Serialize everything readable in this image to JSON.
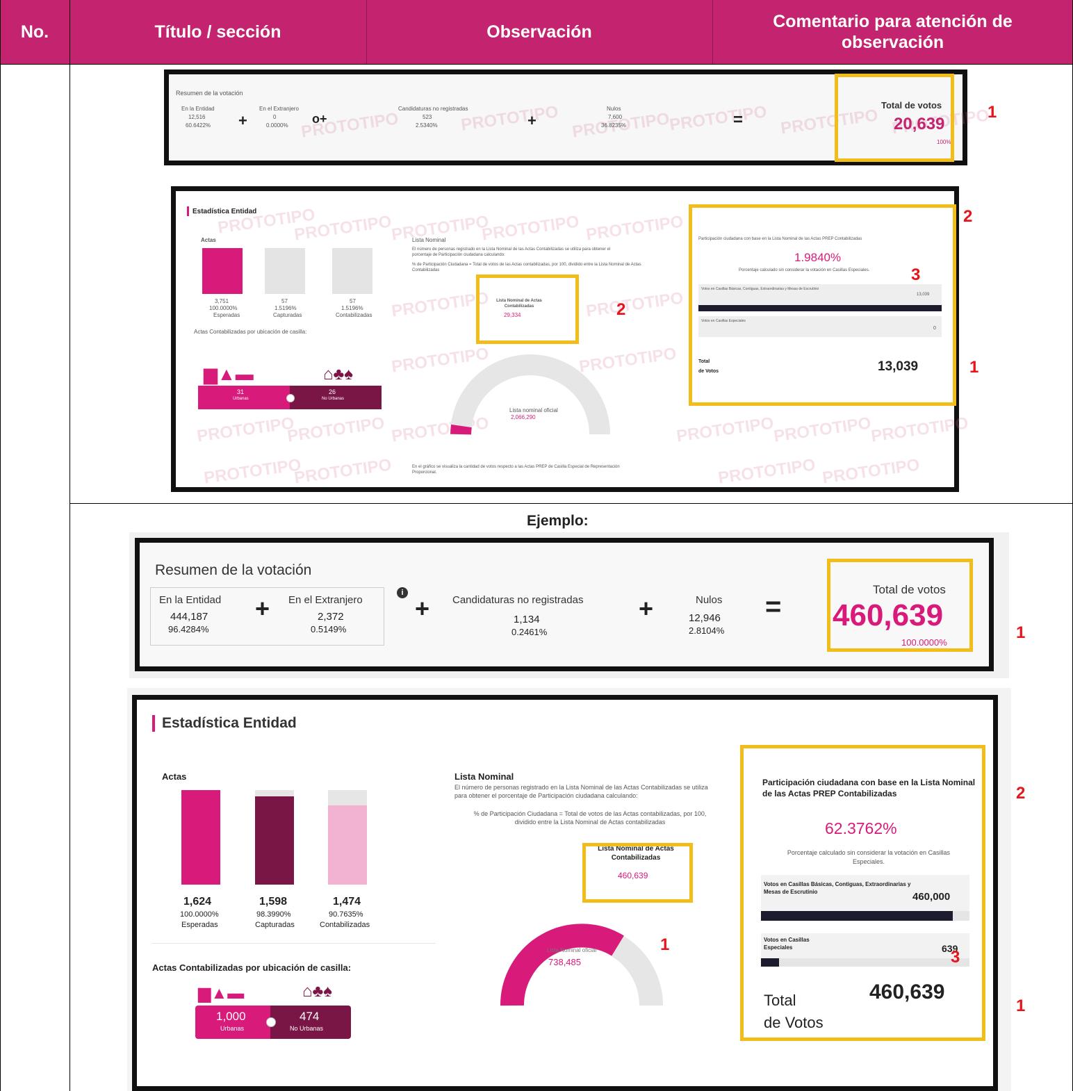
{
  "header": {
    "col_no": "No.",
    "col_title": "Título / sección",
    "col_obs": "Observación",
    "col_comment": "Comentario para atención de observación"
  },
  "watermark": "PROTOTIPO",
  "markers": {
    "m1": "1",
    "m2": "2",
    "m3": "3"
  },
  "ejemplo_label": "Ejemplo:",
  "small_resumen": {
    "title": "Resumen de la votación",
    "entidad_label": "En la Entidad",
    "entidad_value": "12,516",
    "entidad_pct": "60.6422%",
    "extranjero_label": "En el Extranjero",
    "extranjero_value": "0",
    "extranjero_pct": "0.0000%",
    "no_reg_label": "Candidaturas no registradas",
    "no_reg_value": "523",
    "no_reg_pct": "2.5340%",
    "nulos_label": "Nulos",
    "nulos_value": "7,600",
    "nulos_pct": "36.8235%",
    "total_label": "Total de votos",
    "total_value": "20,639",
    "total_pct": "100%"
  },
  "small_stats": {
    "title": "Estadística Entidad",
    "actas_label": "Actas",
    "bars": [
      {
        "value": "3,751",
        "pct": "100.0000%",
        "label": "Esperadas"
      },
      {
        "value": "57",
        "pct": "1.5196%",
        "label": "Capturadas"
      },
      {
        "value": "57",
        "pct": "1.5196%",
        "label": "Contabilizadas"
      }
    ],
    "ubicacion_label": "Actas Contabilizadas por ubicación de casilla:",
    "urbanas_value": "31",
    "urbanas_label": "Urbanas",
    "nourbanas_value": "26",
    "nourbanas_label": "No Urbanas",
    "lista_title": "Lista Nominal",
    "lista_text1": "El número de personas registrado en la Lista Nominal de las Actas Contabilizadas se utiliza para obtener el porcentaje de Participación ciudadana calculando:",
    "lista_text2": "% de Participación Ciudadana = Total de votos de las Actas contabilizadas, por 100, dividido entre la Lista Nominal de Actas Contabilizadas",
    "lista_box_label": "Lista Nominal de Actas Contabilizadas",
    "lista_box_value": "29,334",
    "gauge_label": "Lista nominal oficial",
    "gauge_value": "2,066,290",
    "footnote": "En el gráfico se visualiza la cantidad de votos respecto a las Actas PREP de Casilla Especial de Representación Proporcional.",
    "part_title": "Participación ciudadana con base en la Lista Nominal de las Actas PREP Contabilizadas",
    "part_value": "1.9840%",
    "part_note": "Porcentaje calculado sin considerar la votación en Casillas Especiales.",
    "basicas_label": "Votos en Casillas Básicas, Contiguas, Extraordinarias y Mesas de Escrutinio",
    "basicas_value": "13,039",
    "especiales_label": "Votos en Casillas Especiales",
    "especiales_value": "0",
    "total_label1": "Total",
    "total_label2": "de Votos",
    "total_value": "13,039"
  },
  "ex_resumen": {
    "title": "Resumen de la votación",
    "entidad_label": "En la Entidad",
    "entidad_value": "444,187",
    "entidad_pct": "96.4284%",
    "extranjero_label": "En el Extranjero",
    "extranjero_value": "2,372",
    "extranjero_pct": "0.5149%",
    "no_reg_label": "Candidaturas no registradas",
    "no_reg_value": "1,134",
    "no_reg_pct": "0.2461%",
    "nulos_label": "Nulos",
    "nulos_value": "12,946",
    "nulos_pct": "2.8104%",
    "total_label": "Total de votos",
    "total_value": "460,639",
    "total_pct": "100.0000%"
  },
  "ex_stats": {
    "title": "Estadística Entidad",
    "actas_label": "Actas",
    "bars": [
      {
        "value": "1,624",
        "pct": "100.0000%",
        "label": "Esperadas"
      },
      {
        "value": "1,598",
        "pct": "98.3990%",
        "label": "Capturadas"
      },
      {
        "value": "1,474",
        "pct": "90.7635%",
        "label": "Contabilizadas"
      }
    ],
    "ubicacion_label": "Actas Contabilizadas por ubicación de casilla:",
    "urbanas_value": "1,000",
    "urbanas_label": "Urbanas",
    "nourbanas_value": "474",
    "nourbanas_label": "No Urbanas",
    "lista_title": "Lista  Nominal",
    "lista_text1": "El número de personas registrado en la Lista Nominal de las Actas Contabilizadas se utiliza para obtener el porcentaje de Participación ciudadana calculando:",
    "lista_text2": "% de Participación Ciudadana = Total de votos de las Actas contabilizadas, por 100, dividido entre la Lista Nominal de Actas contabilizadas",
    "lista_box_label": "Lista Nominal de Actas Contabilizadas",
    "lista_box_value": "460,639",
    "gauge_label": "Lista Nominal oficial",
    "gauge_value": "738,485",
    "part_title": "Participación ciudadana con base en la Lista Nominal de las Actas PREP Contabilizadas",
    "part_value": "62.3762%",
    "part_note": "Porcentaje calculado sin considerar la votación en Casillas Especiales.",
    "basicas_label": "Votos en Casillas Básicas, Contiguas, Extraordinarias y Mesas de Escrutinio",
    "basicas_value": "460,000",
    "especiales_label": "Votos en Casillas Especiales",
    "especiales_value": "639",
    "total_label1": "Total",
    "total_label2": "de Votos",
    "total_value": "460,639"
  },
  "colors": {
    "header": "#c4236f",
    "accent": "#d81b7a",
    "dark": "#7a1646",
    "highlight": "#f2bd1b",
    "marker": "#e8141c"
  }
}
